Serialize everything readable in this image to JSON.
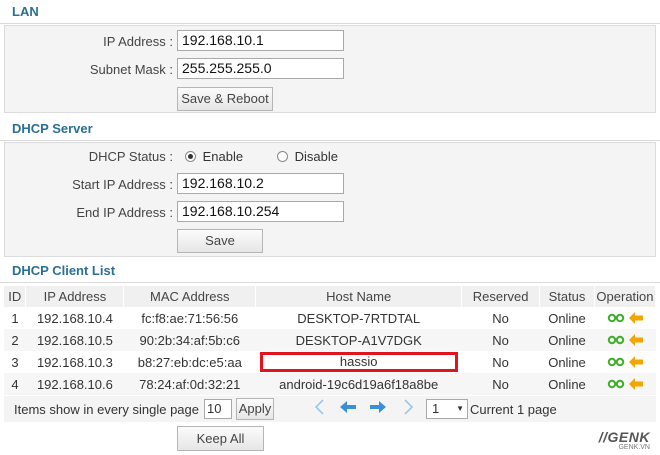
{
  "lan": {
    "title": "LAN",
    "ip_label": "IP Address :",
    "ip_value": "192.168.10.1",
    "mask_label": "Subnet Mask :",
    "mask_value": "255.255.255.0",
    "save_reboot": "Save & Reboot"
  },
  "dhcp": {
    "title": "DHCP Server",
    "status_label": "DHCP Status :",
    "enable": "Enable",
    "disable": "Disable",
    "start_label": "Start IP Address :",
    "start_value": "192.168.10.2",
    "end_label": "End IP Address :",
    "end_value": "192.168.10.254",
    "save": "Save"
  },
  "clients": {
    "title": "DHCP Client List",
    "headers": [
      "ID",
      "IP Address",
      "MAC Address",
      "Host Name",
      "Reserved",
      "Status",
      "Operation"
    ],
    "rows": [
      {
        "id": "1",
        "ip": "192.168.10.4",
        "mac": "fc:f8:ae:71:56:56",
        "host": "DESKTOP-7RTDTAL",
        "reserved": "No",
        "status": "Online"
      },
      {
        "id": "2",
        "ip": "192.168.10.5",
        "mac": "90:2b:34:af:5b:c6",
        "host": "DESKTOP-A1V7DGK",
        "reserved": "No",
        "status": "Online"
      },
      {
        "id": "3",
        "ip": "192.168.10.3",
        "mac": "b8:27:eb:dc:e5:aa",
        "host": "hassio",
        "reserved": "No",
        "status": "Online"
      },
      {
        "id": "4",
        "ip": "192.168.10.6",
        "mac": "78:24:af:0d:32:21",
        "host": "android-19c6d19a6f18a8be",
        "reserved": "No",
        "status": "Online"
      }
    ],
    "items_label": "Items show in every single page",
    "items_value": "10",
    "apply": "Apply",
    "page_select": "1",
    "current_page": "Current 1 page",
    "keep_all": "Keep All"
  },
  "watermark": {
    "brand": "GENK",
    "site": "GENK.VN"
  },
  "colors": {
    "title": "#2a6f96",
    "highlight": "#e0141e",
    "link_icon": "#3fae2a",
    "arrow_icon": "#f0a800",
    "pager": "#3a8fd6"
  }
}
